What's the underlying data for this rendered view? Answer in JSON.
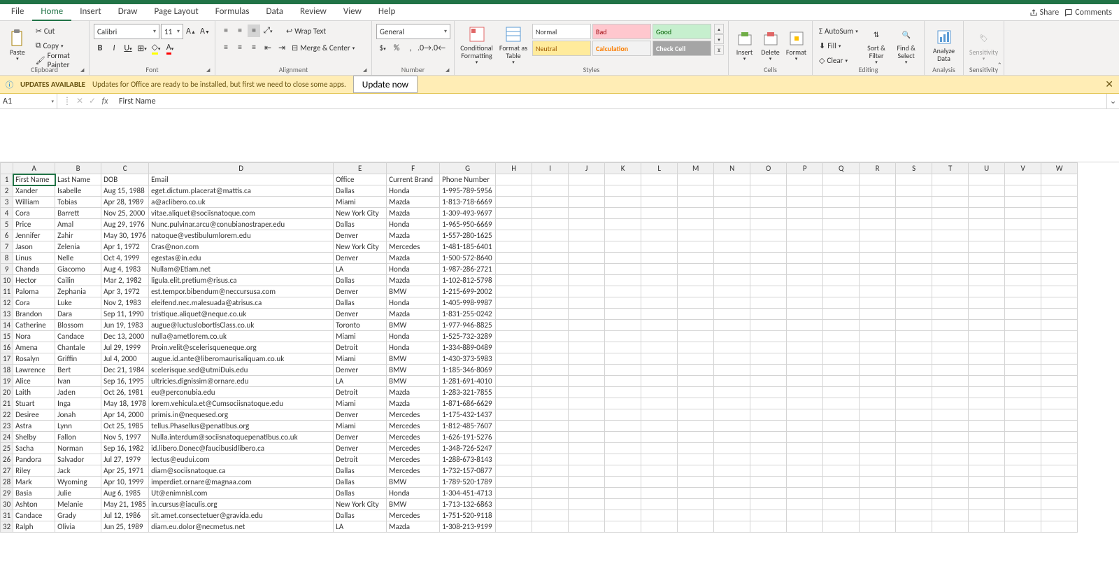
{
  "app": {
    "share": "Share",
    "comments": "Comments"
  },
  "tabs": [
    "File",
    "Home",
    "Insert",
    "Draw",
    "Page Layout",
    "Formulas",
    "Data",
    "Review",
    "View",
    "Help"
  ],
  "activeTab": 1,
  "clipboard": {
    "cut": "Cut",
    "copy": "Copy",
    "paint": "Format Painter",
    "label": "Clipboard"
  },
  "font": {
    "name": "Calibri",
    "size": "11",
    "label": "Font"
  },
  "alignment": {
    "wrap": "Wrap Text",
    "merge": "Merge & Center",
    "label": "Alignment"
  },
  "number": {
    "format": "General",
    "label": "Number"
  },
  "styles": {
    "cond": "Conditional Formatting",
    "fmtTable": "Format as Table",
    "normal": "Normal",
    "bad": "Bad",
    "good": "Good",
    "neutral": "Neutral",
    "calc": "Calculation",
    "check": "Check Cell",
    "label": "Styles"
  },
  "cells": {
    "insert": "Insert",
    "delete": "Delete",
    "format": "Format",
    "label": "Cells"
  },
  "editing": {
    "sum": "AutoSum",
    "fill": "Fill",
    "clear": "Clear",
    "sort": "Sort & Filter",
    "find": "Find & Select",
    "label": "Editing"
  },
  "analysis": {
    "analyze": "Analyze Data",
    "label": "Analysis"
  },
  "sens": {
    "btn": "Sensitivity",
    "label": "Sensitivity"
  },
  "update": {
    "title": "UPDATES AVAILABLE",
    "msg": "Updates for Office are ready to be installed, but first we need to close some apps.",
    "btn": "Update now"
  },
  "nameBox": "A1",
  "formula": "First Name",
  "columns": [
    "A",
    "B",
    "C",
    "D",
    "E",
    "F",
    "G",
    "H",
    "I",
    "J",
    "K",
    "L",
    "M",
    "N",
    "O",
    "P",
    "Q",
    "R",
    "S",
    "T",
    "U",
    "V",
    "W"
  ],
  "headers": [
    "First Name",
    "Last Name",
    "DOB",
    "Email",
    "Office",
    "Current Brand",
    "Phone Number"
  ],
  "rows": [
    [
      "Xander",
      "Isabelle",
      "Aug 15, 1988",
      "eget.dictum.placerat@mattis.ca",
      "Dallas",
      "Honda",
      "1-995-789-5956"
    ],
    [
      "William",
      "Tobias",
      "Apr 28, 1989",
      "a@aclibero.co.uk",
      "Miami",
      "Mazda",
      "1-813-718-6669"
    ],
    [
      "Cora",
      "Barrett",
      "Nov 25, 2000",
      "vitae.aliquet@sociisnatoque.com",
      "New York City",
      "Mazda",
      "1-309-493-9697"
    ],
    [
      "Price",
      "Amal",
      "Aug 29, 1976",
      "Nunc.pulvinar.arcu@conubianostraper.edu",
      "Dallas",
      "Honda",
      "1-965-950-6669"
    ],
    [
      "Jennifer",
      "Zahir",
      "May 30, 1976",
      "natoque@vestibulumlorem.edu",
      "Denver",
      "Mazda",
      "1-557-280-1625"
    ],
    [
      "Jason",
      "Zelenia",
      "Apr 1, 1972",
      "Cras@non.com",
      "New York City",
      "Mercedes",
      "1-481-185-6401"
    ],
    [
      "Linus",
      "Nelle",
      "Oct 4, 1999",
      "egestas@in.edu",
      "Denver",
      "Mazda",
      "1-500-572-8640"
    ],
    [
      "Chanda",
      "Giacomo",
      "Aug 4, 1983",
      "Nullam@Etiam.net",
      "LA",
      "Honda",
      "1-987-286-2721"
    ],
    [
      "Hector",
      "Cailin",
      "Mar 2, 1982",
      "ligula.elit.pretium@risus.ca",
      "Dallas",
      "Mazda",
      "1-102-812-5798"
    ],
    [
      "Paloma",
      "Zephania",
      "Apr 3, 1972",
      "est.tempor.bibendum@neccursusa.com",
      "Denver",
      "BMW",
      "1-215-699-2002"
    ],
    [
      "Cora",
      "Luke",
      "Nov 2, 1983",
      "eleifend.nec.malesuada@atrisus.ca",
      "Dallas",
      "Honda",
      "1-405-998-9987"
    ],
    [
      "Brandon",
      "Dara",
      "Sep 11, 1990",
      "tristique.aliquet@neque.co.uk",
      "Denver",
      "Mazda",
      "1-831-255-0242"
    ],
    [
      "Catherine",
      "Blossom",
      "Jun 19, 1983",
      "augue@luctuslobortisClass.co.uk",
      "Toronto",
      "BMW",
      "1-977-946-8825"
    ],
    [
      "Nora",
      "Candace",
      "Dec 13, 2000",
      "nulla@ametlorem.co.uk",
      "Miami",
      "Honda",
      "1-525-732-3289"
    ],
    [
      "Amena",
      "Chantale",
      "Jul 29, 1999",
      "Proin.velit@scelerisqueneque.org",
      "Detroit",
      "Honda",
      "1-334-889-0489"
    ],
    [
      "Rosalyn",
      "Griffin",
      "Jul 4, 2000",
      "augue.id.ante@liberomaurisaliquam.co.uk",
      "Miami",
      "BMW",
      "1-430-373-5983"
    ],
    [
      "Lawrence",
      "Bert",
      "Dec 21, 1984",
      "scelerisque.sed@utmiDuis.edu",
      "Denver",
      "BMW",
      "1-185-346-8069"
    ],
    [
      "Alice",
      "Ivan",
      "Sep 16, 1995",
      "ultricies.dignissim@ornare.edu",
      "LA",
      "BMW",
      "1-281-691-4010"
    ],
    [
      "Laith",
      "Jaden",
      "Oct 26, 1981",
      "eu@perconubia.edu",
      "Detroit",
      "Mazda",
      "1-283-321-7855"
    ],
    [
      "Stuart",
      "Inga",
      "May 18, 1978",
      "lorem.vehicula.et@Cumsociisnatoque.edu",
      "Miami",
      "Mazda",
      "1-871-686-6629"
    ],
    [
      "Desiree",
      "Jonah",
      "Apr 14, 2000",
      "primis.in@nequesed.org",
      "Denver",
      "Mercedes",
      "1-175-432-1437"
    ],
    [
      "Astra",
      "Lynn",
      "Oct 25, 1985",
      "tellus.Phasellus@penatibus.org",
      "Miami",
      "Mercedes",
      "1-812-485-7607"
    ],
    [
      "Shelby",
      "Fallon",
      "Nov 5, 1997",
      "Nulla.interdum@sociisnatoquepenatibus.co.uk",
      "Denver",
      "Mercedes",
      "1-626-191-5276"
    ],
    [
      "Sacha",
      "Norman",
      "Sep 16, 1982",
      "id.libero.Donec@faucibusidlibero.ca",
      "Denver",
      "Mercedes",
      "1-348-726-5247"
    ],
    [
      "Pandora",
      "Salvador",
      "Jul 27, 1979",
      "lectus@eudui.com",
      "Detroit",
      "Mercedes",
      "1-288-673-8143"
    ],
    [
      "Riley",
      "Jack",
      "Apr 25, 1971",
      "diam@sociisnatoque.ca",
      "Dallas",
      "Mercedes",
      "1-732-157-0877"
    ],
    [
      "Mark",
      "Wyoming",
      "Apr 10, 1999",
      "imperdiet.ornare@magnaa.com",
      "Dallas",
      "BMW",
      "1-789-520-1789"
    ],
    [
      "Basia",
      "Julie",
      "Aug 6, 1985",
      "Ut@enimnisl.com",
      "Dallas",
      "Honda",
      "1-304-451-4713"
    ],
    [
      "Ashton",
      "Melanie",
      "May 21, 1985",
      "in.cursus@iaculis.org",
      "New York City",
      "BMW",
      "1-713-132-6863"
    ],
    [
      "Candace",
      "Grady",
      "Jul 12, 1986",
      "sit.amet.consectetuer@gravida.edu",
      "Dallas",
      "Mercedes",
      "1-751-520-9118"
    ],
    [
      "Ralph",
      "Olivia",
      "Jun 25, 1989",
      "diam.eu.dolor@necmetus.net",
      "LA",
      "Mazda",
      "1-308-213-9199"
    ]
  ]
}
